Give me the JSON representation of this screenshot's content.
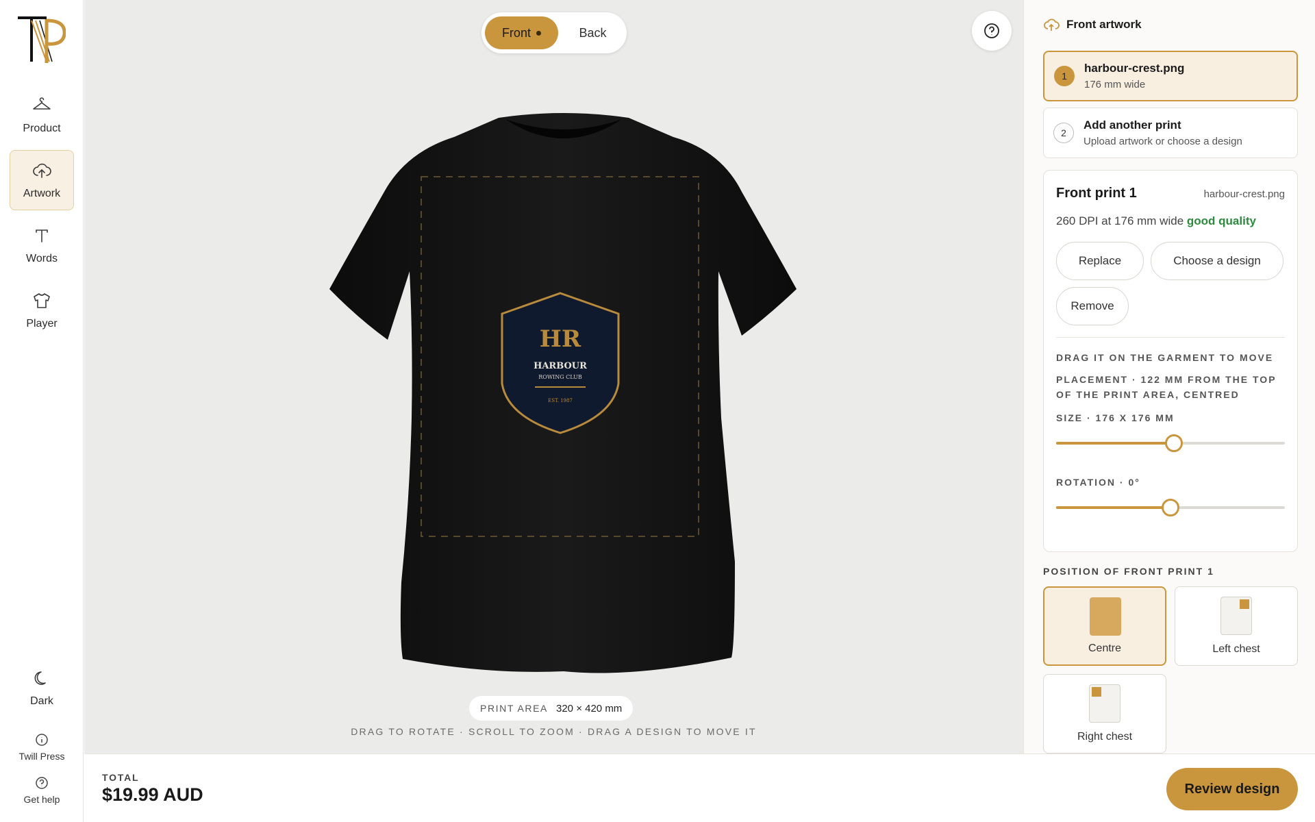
{
  "brand": {
    "logo_alt": "TP"
  },
  "rail": {
    "items": [
      {
        "label": "Product",
        "icon": "hanger-icon"
      },
      {
        "label": "Artwork",
        "icon": "upload-cloud-icon"
      },
      {
        "label": "Words",
        "icon": "text-icon"
      },
      {
        "label": "Player",
        "icon": "shirt-icon"
      }
    ],
    "dark_label": "Dark",
    "twill_label": "Twill Press",
    "help_label": "Get help"
  },
  "view": {
    "front_label": "Front",
    "back_label": "Back",
    "selected": "Front"
  },
  "crest": {
    "initials": "HR",
    "name": "HARBOUR",
    "subname": "ROWING CLUB",
    "est": "EST. 1987"
  },
  "canvas": {
    "print_area_label": "PRINT AREA",
    "print_area_value": "320 × 420 mm",
    "hint": "DRAG TO ROTATE · SCROLL TO ZOOM · DRAG A DESIGN TO MOVE IT"
  },
  "panel": {
    "title": "Front artwork",
    "slots": [
      {
        "num": "1",
        "title": "harbour-crest.png",
        "sub": "176 mm wide"
      },
      {
        "num": "2",
        "title": "Add another print",
        "sub": "Upload artwork or choose a design"
      }
    ],
    "card": {
      "heading": "Front print 1",
      "file": "harbour-crest.png",
      "dpi_text": "260 DPI at 176 mm wide",
      "quality": "good quality",
      "replace": "Replace",
      "choose": "Choose a design",
      "remove": "Remove",
      "drag_hint": "DRAG IT ON THE GARMENT TO MOVE",
      "placement": "PLACEMENT · 122 MM FROM THE TOP OF THE PRINT AREA, CENTRED",
      "size_label": "SIZE · 176 X 176 MM",
      "size_fraction": 0.515,
      "rotation_label": "ROTATION · 0°",
      "rotation_fraction": 0.5
    },
    "position_label": "POSITION OF FRONT PRINT 1",
    "positions": [
      {
        "label": "Centre",
        "selected": true
      },
      {
        "label": "Left chest",
        "selected": false
      },
      {
        "label": "Right chest",
        "selected": false
      }
    ]
  },
  "footer": {
    "total_label": "TOTAL",
    "total_value": "$19.99 AUD",
    "review": "Review design"
  },
  "colors": {
    "accent": "#c9963e",
    "good": "#2d8a3e",
    "shirt": "#141414",
    "crest_bg": "#0f1a2e"
  }
}
